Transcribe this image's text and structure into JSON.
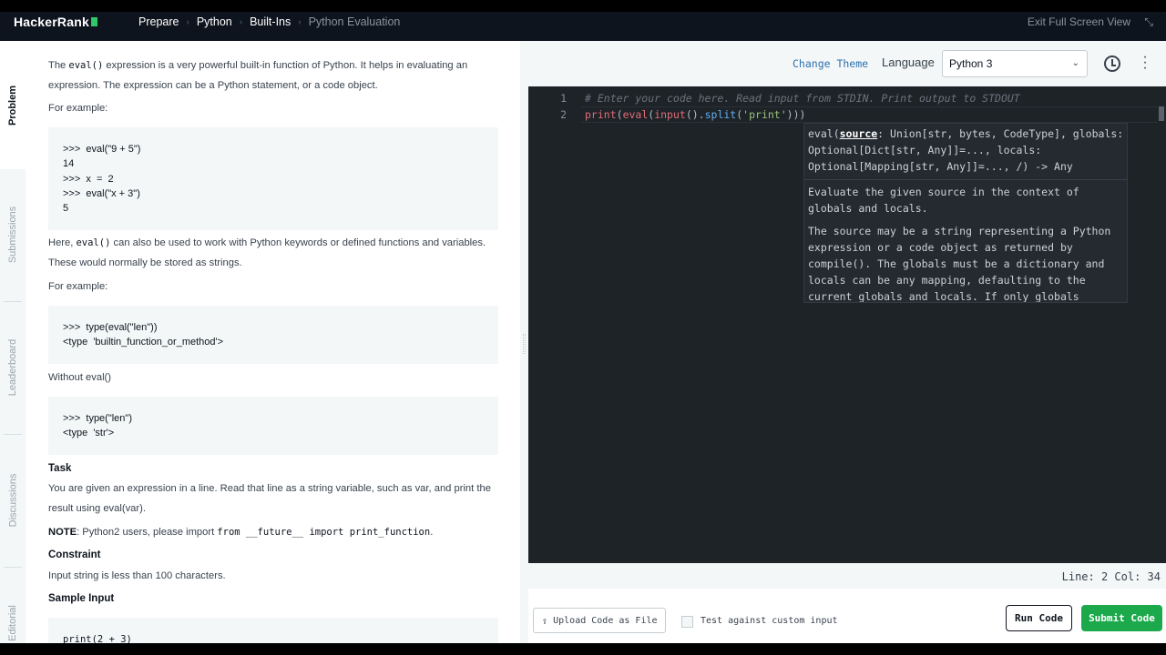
{
  "header": {
    "brand": "HackerRank",
    "breadcrumbs": [
      "Prepare",
      "Python",
      "Built-Ins",
      "Python Evaluation"
    ],
    "exit_fullscreen": "Exit Full Screen View"
  },
  "side_tabs": [
    "Problem",
    "Submissions",
    "Leaderboard",
    "Discussions",
    "Editorial"
  ],
  "problem": {
    "p1_a": "The ",
    "p1_code": "eval()",
    "p1_b": " expression is a very powerful built-in function of Python. It helps in evaluating an expression. The expression can be a Python statement, or a code object.",
    "for_example_1": "For example:",
    "example1": [
      ">>>  eval(\"9 + 5\")",
      "14",
      ">>>  x  =  2",
      ">>>  eval(\"x + 3\")",
      "5"
    ],
    "p2_a": "Here, ",
    "p2_code": "eval()",
    "p2_b": " can also be used to work with Python keywords or defined functions and variables. These would normally be stored as strings.",
    "for_example_2": "For example:",
    "example2": [
      ">>>  type(eval(\"len\"))",
      "<type  'builtin_function_or_method'>"
    ],
    "without_eval": "Without eval()",
    "example3": [
      ">>>  type(\"len\")",
      "<type  'str'>"
    ],
    "task_heading": "Task",
    "task_text": "You are given an expression in a line. Read that line as a string variable, such as var, and print the result using eval(var).",
    "note_label": "NOTE",
    "note_a": ": Python2 users, please import ",
    "note_code": "from __future__ import print_function",
    "note_b": ".",
    "constraint_heading": "Constraint",
    "constraint_text": "Input string is less than 100 characters.",
    "sample_heading": "Sample Input",
    "sample_code": "print(2 + 3)"
  },
  "editor": {
    "change_theme": "Change Theme",
    "language_label": "Language",
    "language_value": "Python 3",
    "line_numbers": [
      "1",
      "2"
    ],
    "line1": "# Enter your code here. Read input from STDIN. Print output to STDOUT",
    "line2": {
      "t1": "print",
      "t2": "(",
      "t3": "eval",
      "t4": "(",
      "t5": "input",
      "t6": "().",
      "t7": "split",
      "t8": "(",
      "t9": "'print'",
      "t10": ")",
      "t11": "))"
    },
    "tooltip": {
      "sig_pre": "eval(",
      "sig_param": "source",
      "sig_rest": ": Union[str, bytes, CodeType], globals: Optional[Dict[str, Any]]=..., locals: Optional[Mapping[str, Any]]=..., /) -> Any",
      "doc1": "Evaluate the given source in the context of globals and locals.",
      "doc2": "The source may be a string representing a Python expression or a code object as returned by compile(). The globals must be a dictionary and locals can be any mapping, defaulting to the current globals and locals. If only globals"
    },
    "status": "Line: 2 Col: 34"
  },
  "actions": {
    "upload": "Upload Code as File",
    "custom_input": "Test against custom input",
    "run": "Run Code",
    "submit": "Submit Code"
  }
}
